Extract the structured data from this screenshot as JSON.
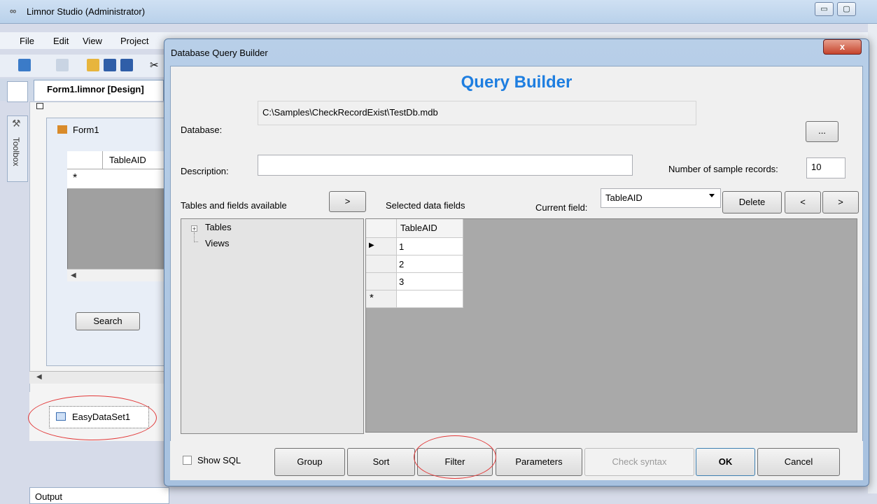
{
  "ide": {
    "title": "Limnor Studio (Administrator)",
    "logo": "∞",
    "window_buttons": [
      "▭",
      "▢"
    ],
    "menu": [
      "File",
      "Edit",
      "View",
      "Project"
    ],
    "design_tab": "Form1.limnor [Design]",
    "toolbox": "Toolbox",
    "form_title": "Form1",
    "grid_column": "TableAID",
    "grid_new_row": "*",
    "search_button": "Search",
    "component": "EasyDataSet1",
    "output": "Output"
  },
  "dialog": {
    "title": "Database Query Builder",
    "close": "x",
    "header": "Query Builder",
    "database_label": "Database:",
    "database_path": "C:\\Samples\\CheckRecordExist\\TestDb.mdb",
    "browse": "...",
    "description_label": "Description:",
    "description_value": "",
    "samples_label": "Number of sample records:",
    "samples_value": "10",
    "tables_label": "Tables and fields available",
    "add_button": ">",
    "selected_label": "Selected data fields",
    "current_field_label": "Current field:",
    "current_field_value": "TableAID",
    "delete_button": "Delete",
    "move_left": "<",
    "move_right": ">",
    "tree": [
      "Tables",
      "Views"
    ],
    "grid": {
      "column": "TableAID",
      "rows": [
        "1",
        "2",
        "3"
      ],
      "current_row_marker": "▶",
      "new_row_marker": "*"
    },
    "show_sql": "Show SQL",
    "buttons": {
      "group": "Group",
      "sort": "Sort",
      "filter": "Filter",
      "parameters": "Parameters",
      "check_syntax": "Check syntax",
      "ok": "OK",
      "cancel": "Cancel"
    }
  },
  "colors": {
    "header_blue": "#1e7ee0",
    "highlight_ellipse": "#e23a3a"
  }
}
